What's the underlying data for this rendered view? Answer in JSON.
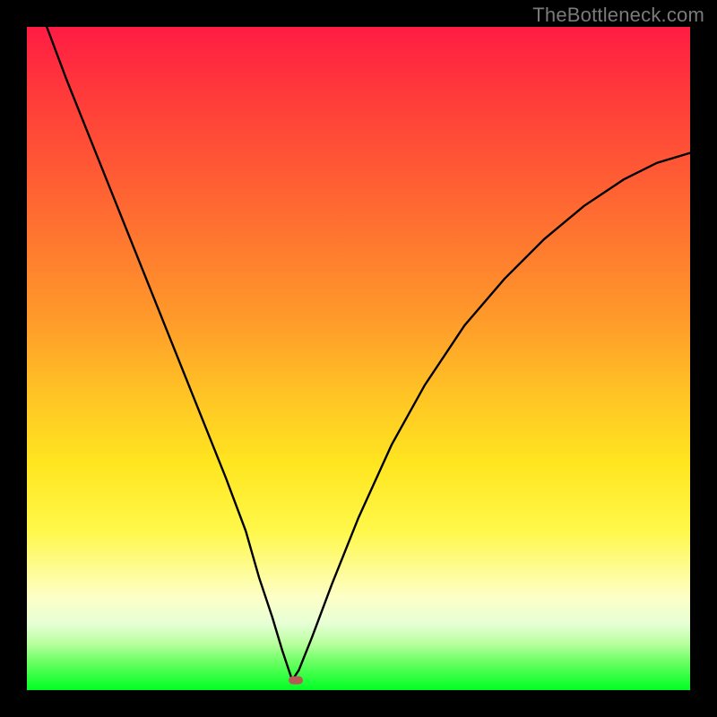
{
  "attribution": "TheBottleneck.com",
  "colors": {
    "frame": "#000000",
    "gradient_stops": [
      "#ff1c44",
      "#ff3a3a",
      "#ff5a34",
      "#ff7a2f",
      "#ff9a2a",
      "#ffc225",
      "#ffe620",
      "#fff84a",
      "#fdffc7",
      "#e6ffd5",
      "#b8ff9e",
      "#64ff5e",
      "#18ff33",
      "#00ff22"
    ],
    "curve": "#000000",
    "marker": "#b75a56",
    "attribution_text": "#7a7a7a"
  },
  "chart_data": {
    "type": "line",
    "title": "",
    "xlabel": "",
    "ylabel": "",
    "xlim": [
      0,
      100
    ],
    "ylim": [
      0,
      100
    ],
    "minimum_at_x": 40,
    "marker": {
      "x": 40.5,
      "y": 1.5
    },
    "series": [
      {
        "name": "left",
        "x": [
          3,
          6,
          10,
          14,
          18,
          22,
          26,
          30,
          33,
          35,
          37,
          38.5,
          39.5,
          40
        ],
        "y": [
          100,
          92,
          82,
          72,
          62,
          52,
          42,
          32,
          24,
          17,
          11,
          6,
          3,
          1.5
        ]
      },
      {
        "name": "right",
        "x": [
          40,
          41,
          43,
          46,
          50,
          55,
          60,
          66,
          72,
          78,
          84,
          90,
          95,
          100
        ],
        "y": [
          1.5,
          3,
          8,
          16,
          26,
          37,
          46,
          55,
          62,
          68,
          73,
          77,
          79.5,
          81
        ]
      }
    ]
  }
}
